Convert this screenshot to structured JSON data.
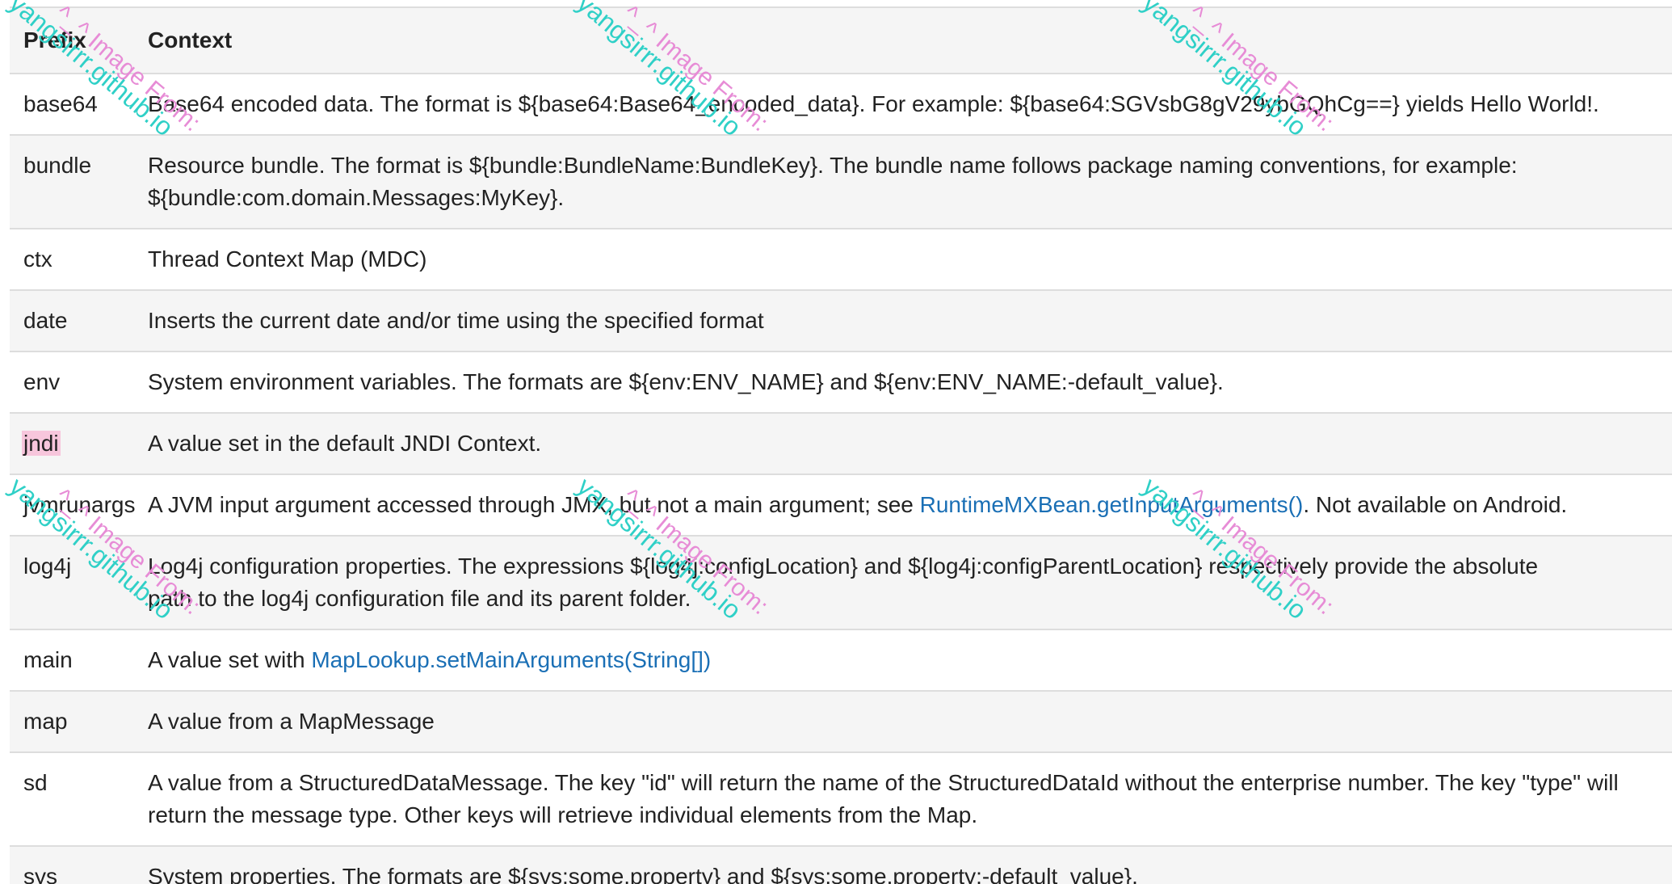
{
  "table": {
    "headers": {
      "prefix": "Prefix",
      "context": "Context"
    },
    "rows": [
      {
        "prefix": "base64",
        "context": "Base64 encoded data. The format is ${base64:Base64_encoded_data}. For example: ${base64:SGVsbG8gV29ybGQhCg==} yields Hello World!."
      },
      {
        "prefix": "bundle",
        "context": "Resource bundle. The format is ${bundle:BundleName:BundleKey}. The bundle name follows package naming conventions, for example: ${bundle:com.domain.Messages:MyKey}."
      },
      {
        "prefix": "ctx",
        "context": "Thread Context Map (MDC)"
      },
      {
        "prefix": "date",
        "context": "Inserts the current date and/or time using the specified format"
      },
      {
        "prefix": "env",
        "context": "System environment variables. The formats are ${env:ENV_NAME} and ${env:ENV_NAME:-default_value}."
      },
      {
        "prefix": "jndi",
        "context": "A value set in the default JNDI Context."
      },
      {
        "prefix": "jvmrunargs",
        "context_before": "A JVM input argument accessed through JMX, but not a main argument; see ",
        "context_link": "RuntimeMXBean.getInputArguments()",
        "context_after": ". Not available on Android."
      },
      {
        "prefix": "log4j",
        "context": "Log4j configuration properties. The expressions ${log4j:configLocation} and ${log4j:configParentLocation} respectively provide the absolute path to the log4j configuration file and its parent folder."
      },
      {
        "prefix": "main",
        "context_before": "A value set with ",
        "context_link": "MapLookup.setMainArguments(String[])"
      },
      {
        "prefix": "map",
        "context": "A value from a MapMessage"
      },
      {
        "prefix": "sd",
        "context": "A value from a StructuredDataMessage. The key \"id\" will return the name of the StructuredDataId without the enterprise number. The key \"type\" will return the message type. Other keys will retrieve individual elements from the Map."
      },
      {
        "prefix": "sys",
        "context": "System properties. The formats are ${sys:some.property} and ${sys:some.property:-default_value}."
      }
    ]
  },
  "watermark": {
    "line1": "^_^ Image From:",
    "line2": "yangsirrr.github.io"
  },
  "colors": {
    "link": "#1a6fb5",
    "highlight": "#f7c6dc",
    "stripe": "#f5f5f5",
    "border": "#dddddd",
    "watermark_pink": "#e78cd6",
    "watermark_teal": "#2fd0c7"
  }
}
